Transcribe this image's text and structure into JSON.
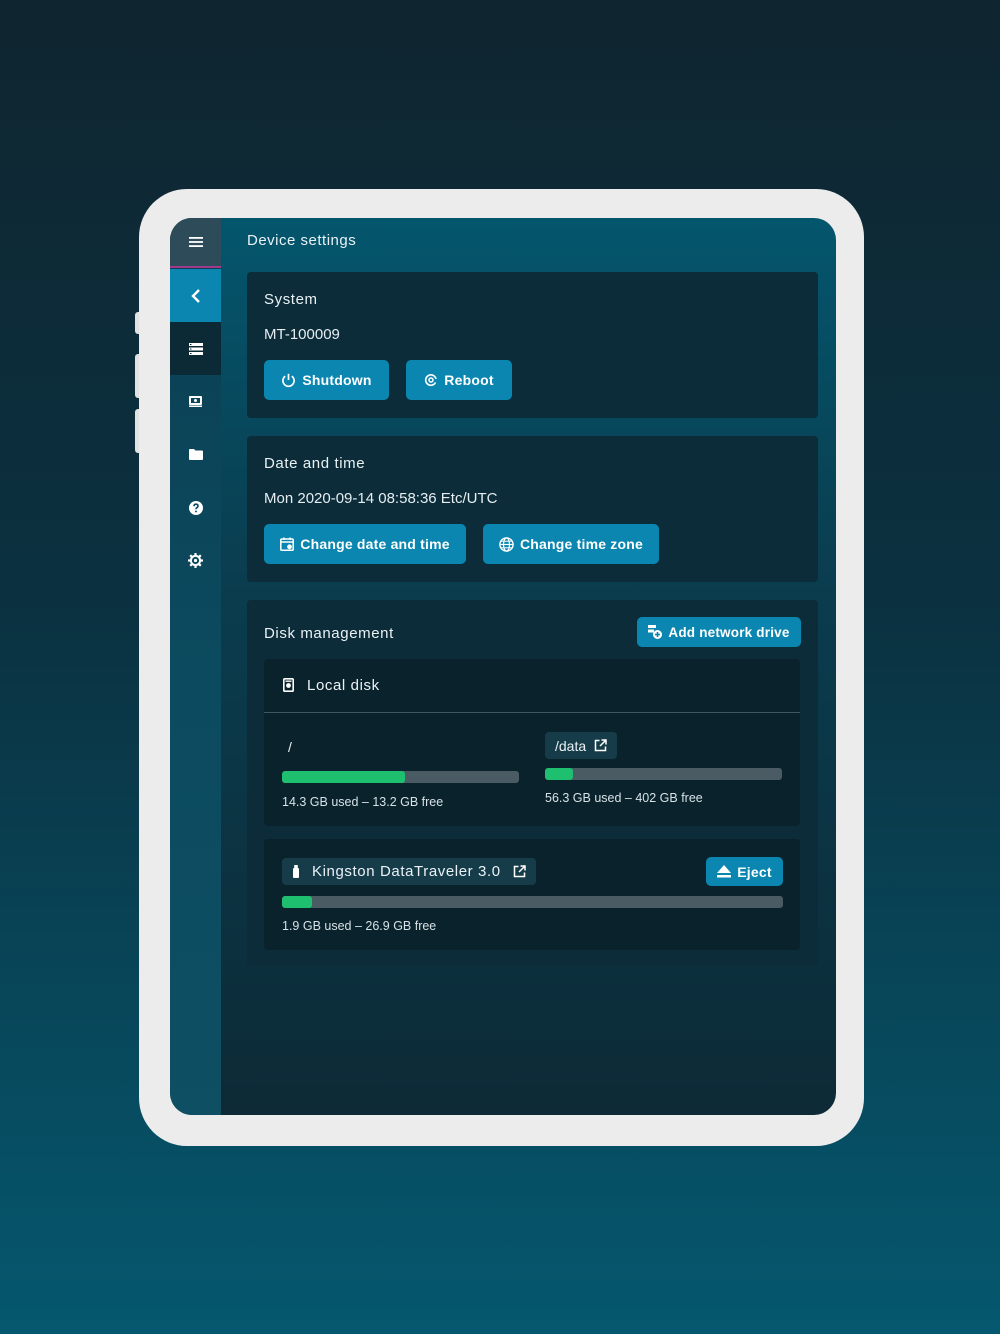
{
  "header": {
    "title": "Device settings"
  },
  "sidebar": {
    "items": [
      {
        "icon": "menu-icon"
      },
      {
        "icon": "chevron-left-icon"
      },
      {
        "icon": "server-list-icon"
      },
      {
        "icon": "monitor-icon"
      },
      {
        "icon": "folder-icon"
      },
      {
        "icon": "help-circle-icon"
      },
      {
        "icon": "settings-icon"
      }
    ]
  },
  "system": {
    "title": "System",
    "device_id": "MT-100009",
    "shutdown_label": "Shutdown",
    "reboot_label": "Reboot"
  },
  "datetime": {
    "title": "Date and time",
    "value": "Mon 2020-09-14 08:58:36 Etc/UTC",
    "change_datetime_label": "Change date and time",
    "change_timezone_label": "Change time zone"
  },
  "disk": {
    "title": "Disk management",
    "add_network_label": "Add network drive",
    "local": {
      "title": "Local disk",
      "partitions": [
        {
          "mount": "/",
          "used_fraction": 0.52,
          "usage": "14.3 GB used – 13.2 GB free"
        },
        {
          "mount": "/data",
          "used_fraction": 0.12,
          "usage": "56.3 GB used – 402 GB free"
        }
      ]
    },
    "usb": {
      "name": "Kingston DataTraveler 3.0",
      "eject_label": "Eject",
      "used_fraction": 0.06,
      "usage": "1.9 GB used – 26.9 GB free"
    }
  },
  "colors": {
    "accent": "#0a86b0",
    "bar_fill": "#1fbf70",
    "bar_track": "#4a5b63",
    "card_bg": "#0b2c38"
  }
}
